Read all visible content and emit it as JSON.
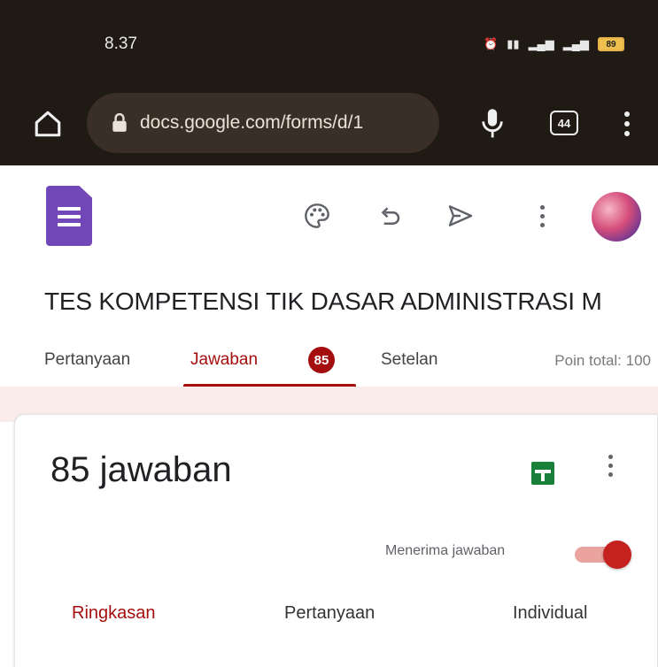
{
  "status_bar": {
    "time": "8.37",
    "battery": "89"
  },
  "browser": {
    "url": "docs.google.com/forms/d/1",
    "tab_count": "44"
  },
  "app_bar": {
    "icons": [
      "google-forms-logo",
      "palette-icon",
      "undo-icon",
      "send-icon",
      "more-vert-icon",
      "avatar"
    ]
  },
  "form": {
    "title": "TES KOMPETENSI TIK DASAR ADMINISTRASI M",
    "tabs": [
      {
        "label": "Pertanyaan"
      },
      {
        "label": "Jawaban",
        "badge": "85",
        "active": true
      },
      {
        "label": "Setelan"
      }
    ],
    "total_points": "Poin total: 100"
  },
  "responses": {
    "count_label": "85 jawaban",
    "accepting_label": "Menerima jawaban",
    "accepting": true,
    "subtabs": [
      {
        "label": "Ringkasan",
        "active": true
      },
      {
        "label": "Pertanyaan"
      },
      {
        "label": "Individual"
      }
    ]
  },
  "colors": {
    "accent": "#a50e0e",
    "forms_purple": "#7248b9",
    "sheets_green": "#188038",
    "status_bg": "#1f1a14"
  }
}
